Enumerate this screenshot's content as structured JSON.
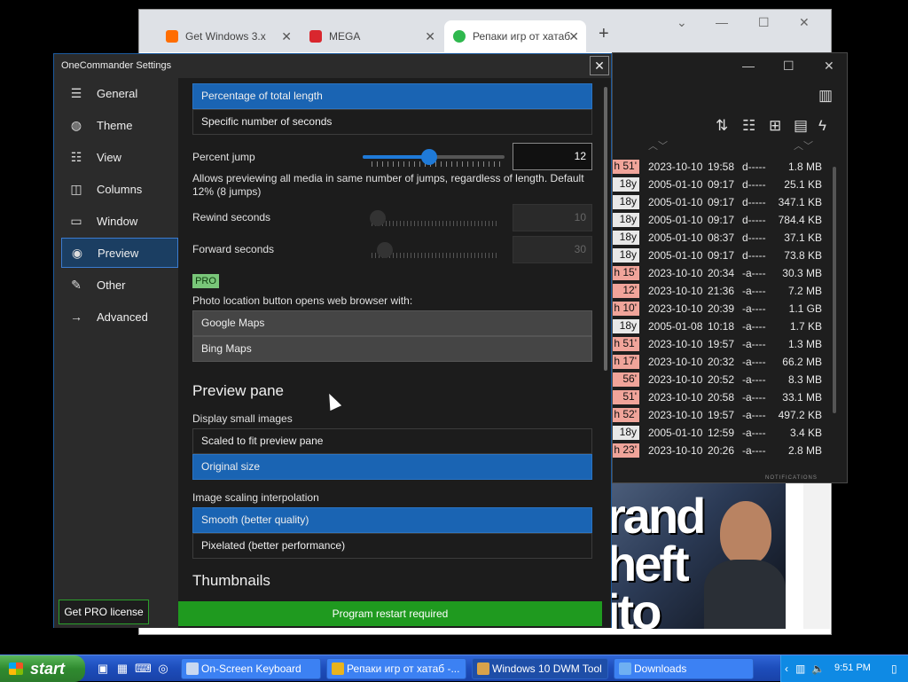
{
  "browser": {
    "tabs": [
      {
        "label": "Get Windows 3.x",
        "favicon_color": "#ff6d00"
      },
      {
        "label": "MEGA",
        "favicon_color": "#d9272e"
      },
      {
        "label": "Репаки игр от хатаб",
        "favicon_color": "#2fb84e"
      }
    ],
    "newtab_symbol": "+",
    "controls": {
      "collapse": "⌄",
      "minimize": "—",
      "maximize": "☐",
      "close": "✕"
    }
  },
  "onecommander": {
    "controls": {
      "minimize": "—",
      "maximize": "☐",
      "close": "✕"
    },
    "files": [
      {
        "age": "h 51'",
        "age_color": "#f0a49a",
        "date": "2023-10-10",
        "time": "19:58",
        "attr": "d-----",
        "size": "1.8 MB"
      },
      {
        "age": "18y",
        "age_color": "#e8e8e8",
        "date": "2005-01-10",
        "time": "09:17",
        "attr": "d-----",
        "size": "25.1 KB"
      },
      {
        "age": "18y",
        "age_color": "#e8e8e8",
        "date": "2005-01-10",
        "time": "09:17",
        "attr": "d-----",
        "size": "347.1 KB"
      },
      {
        "age": "18y",
        "age_color": "#e8e8e8",
        "date": "2005-01-10",
        "time": "09:17",
        "attr": "d-----",
        "size": "784.4 KB"
      },
      {
        "age": "18y",
        "age_color": "#e8e8e8",
        "date": "2005-01-10",
        "time": "08:37",
        "attr": "d-----",
        "size": "37.1 KB"
      },
      {
        "age": "18y",
        "age_color": "#e8e8e8",
        "date": "2005-01-10",
        "time": "09:17",
        "attr": "d-----",
        "size": "73.8 KB"
      },
      {
        "age": "h 15'",
        "age_color": "#f0a49a",
        "date": "2023-10-10",
        "time": "20:34",
        "attr": "-a----",
        "size": "30.3 MB"
      },
      {
        "age": "12'",
        "age_color": "#f0a49a",
        "date": "2023-10-10",
        "time": "21:36",
        "attr": "-a----",
        "size": "7.2 MB"
      },
      {
        "age": "h 10'",
        "age_color": "#f0a49a",
        "date": "2023-10-10",
        "time": "20:39",
        "attr": "-a----",
        "size": "1.1 GB"
      },
      {
        "age": "18y",
        "age_color": "#e8e8e8",
        "date": "2005-01-08",
        "time": "10:18",
        "attr": "-a----",
        "size": "1.7 KB"
      },
      {
        "age": "h 51'",
        "age_color": "#f0a49a",
        "date": "2023-10-10",
        "time": "19:57",
        "attr": "-a----",
        "size": "1.3 MB"
      },
      {
        "age": "h 17'",
        "age_color": "#f0a49a",
        "date": "2023-10-10",
        "time": "20:32",
        "attr": "-a----",
        "size": "66.2 MB"
      },
      {
        "age": "56'",
        "age_color": "#f0a49a",
        "date": "2023-10-10",
        "time": "20:52",
        "attr": "-a----",
        "size": "8.3 MB"
      },
      {
        "age": "51'",
        "age_color": "#f0a49a",
        "date": "2023-10-10",
        "time": "20:58",
        "attr": "-a----",
        "size": "33.1 MB"
      },
      {
        "age": "h 52'",
        "age_color": "#f0a49a",
        "date": "2023-10-10",
        "time": "19:57",
        "attr": "-a----",
        "size": "497.2 KB"
      },
      {
        "age": "18y",
        "age_color": "#e8e8e8",
        "date": "2005-01-10",
        "time": "12:59",
        "attr": "-a----",
        "size": "3.4 KB"
      },
      {
        "age": "h 23'",
        "age_color": "#f0a49a",
        "date": "2023-10-10",
        "time": "20:26",
        "attr": "-a----",
        "size": "2.8 MB"
      }
    ]
  },
  "gta_cover": {
    "line1": "rand",
    "line2": "heft",
    "line3": "ito"
  },
  "settings": {
    "window_title": "OneCommander Settings",
    "close_symbol": "✕",
    "nav": [
      {
        "label": "General",
        "icon": "sliders-icon",
        "glyph": "☰",
        "active": false
      },
      {
        "label": "Theme",
        "icon": "palette-icon",
        "glyph": "◍",
        "active": false
      },
      {
        "label": "View",
        "icon": "list-icon",
        "glyph": "☷",
        "active": false
      },
      {
        "label": "Columns",
        "icon": "columns-icon",
        "glyph": "◫",
        "active": false
      },
      {
        "label": "Window",
        "icon": "window-icon",
        "glyph": "▭",
        "active": false
      },
      {
        "label": "Preview",
        "icon": "eye-icon",
        "glyph": "◉",
        "active": true
      },
      {
        "label": "Other",
        "icon": "edit-icon",
        "glyph": "✎",
        "active": false
      },
      {
        "label": "Advanced",
        "icon": "arrow-right-icon",
        "glyph": "→",
        "active": false
      }
    ],
    "pro_license_button": "Get PRO license",
    "jump_mode_options": [
      {
        "label": "Percentage of total length",
        "selected": true
      },
      {
        "label": "Specific number of seconds",
        "selected": false
      }
    ],
    "percent_jump": {
      "label": "Percent jump",
      "value": "12",
      "level": 0.47
    },
    "percent_jump_help": "Allows previewing all media in same number of jumps, regardless of length. Default 12% (8 jumps)",
    "rewind_seconds": {
      "label": "Rewind seconds",
      "value": "10",
      "level": 0.05
    },
    "forward_seconds": {
      "label": "Forward seconds",
      "value": "30",
      "level": 0.1
    },
    "pro_badge": "PRO",
    "photo_location_label": "Photo location button opens web browser with:",
    "map_options": [
      "Google Maps",
      "Bing Maps"
    ],
    "preview_pane_heading": "Preview pane",
    "small_images_label": "Display small images",
    "small_images_options": [
      {
        "label": "Scaled to fit preview pane",
        "selected": false
      },
      {
        "label": "Original size",
        "selected": true
      }
    ],
    "interpolation_label": "Image scaling interpolation",
    "interpolation_options": [
      {
        "label": "Smooth (better quality)",
        "selected": true
      },
      {
        "label": "Pixelated (better performance)",
        "selected": false
      }
    ],
    "thumbnails_heading": "Thumbnails",
    "restart_bar": "Program restart required",
    "accent_color": "#1a64b3"
  },
  "taskbar": {
    "start_label": "start",
    "buttons": [
      {
        "label": "On-Screen Keyboard",
        "icon": "keyboard-icon",
        "icon_color": "#c9d8f0",
        "active": false
      },
      {
        "label": "Репаки игр от хатаб -...",
        "icon": "chrome-icon",
        "icon_color": "#e8b31d",
        "active": false
      },
      {
        "label": "Windows 10 DWM Tool",
        "icon": "dwm-tool-icon",
        "icon_color": "#d8a24a",
        "active": true
      },
      {
        "label": "Downloads",
        "icon": "folder-icon",
        "icon_color": "#6fb0f2",
        "active": false
      }
    ],
    "clock": "9:51 PM"
  }
}
